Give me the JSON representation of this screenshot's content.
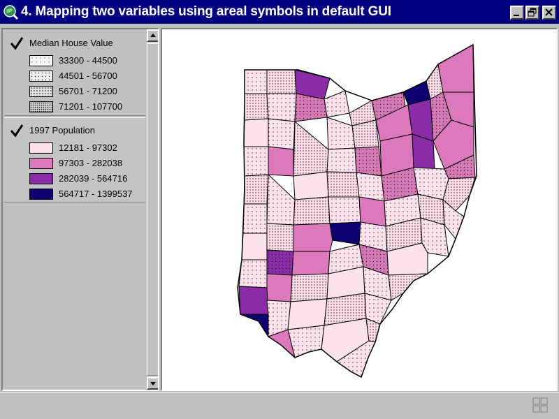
{
  "window": {
    "title": "4. Mapping two variables using areal symbols in default GUI"
  },
  "toc": {
    "layers": [
      {
        "name": "Median House Value",
        "visible": true,
        "classes": [
          {
            "label": "33300 - 44500",
            "fill": "#f4f4f4",
            "dot_density": "light"
          },
          {
            "label": "44501 - 56700",
            "fill": "#e8e8e8",
            "dot_density": "medium"
          },
          {
            "label": "56701 - 71200",
            "fill": "#d8d8d8",
            "dot_density": "dense"
          },
          {
            "label": "71201 - 107700",
            "fill": "#c8c8c8",
            "dot_density": "heavy"
          }
        ]
      },
      {
        "name": "1997 Population",
        "visible": true,
        "classes": [
          {
            "label": "12181 - 97302",
            "fill": "#fbe2ec"
          },
          {
            "label": "97303 - 282038",
            "fill": "#dc78bc"
          },
          {
            "label": "282039 - 564716",
            "fill": "#8a2ca6"
          },
          {
            "label": "564717 - 1399537",
            "fill": "#0e0070"
          }
        ]
      }
    ]
  },
  "status": {
    "text": ""
  },
  "colors": {
    "titlebar": "#000080",
    "face": "#c0c0c0",
    "map_background": "#ffffff",
    "county_outline": "#000000"
  },
  "icons": {
    "app": "globe-magnifier-icon",
    "minimize": "minimize-icon",
    "maximize": "restore-icon",
    "close": "close-icon",
    "scroll_up": "arrow-up-icon",
    "scroll_down": "arrow-down-icon",
    "resize": "resize-grip-icon"
  }
}
